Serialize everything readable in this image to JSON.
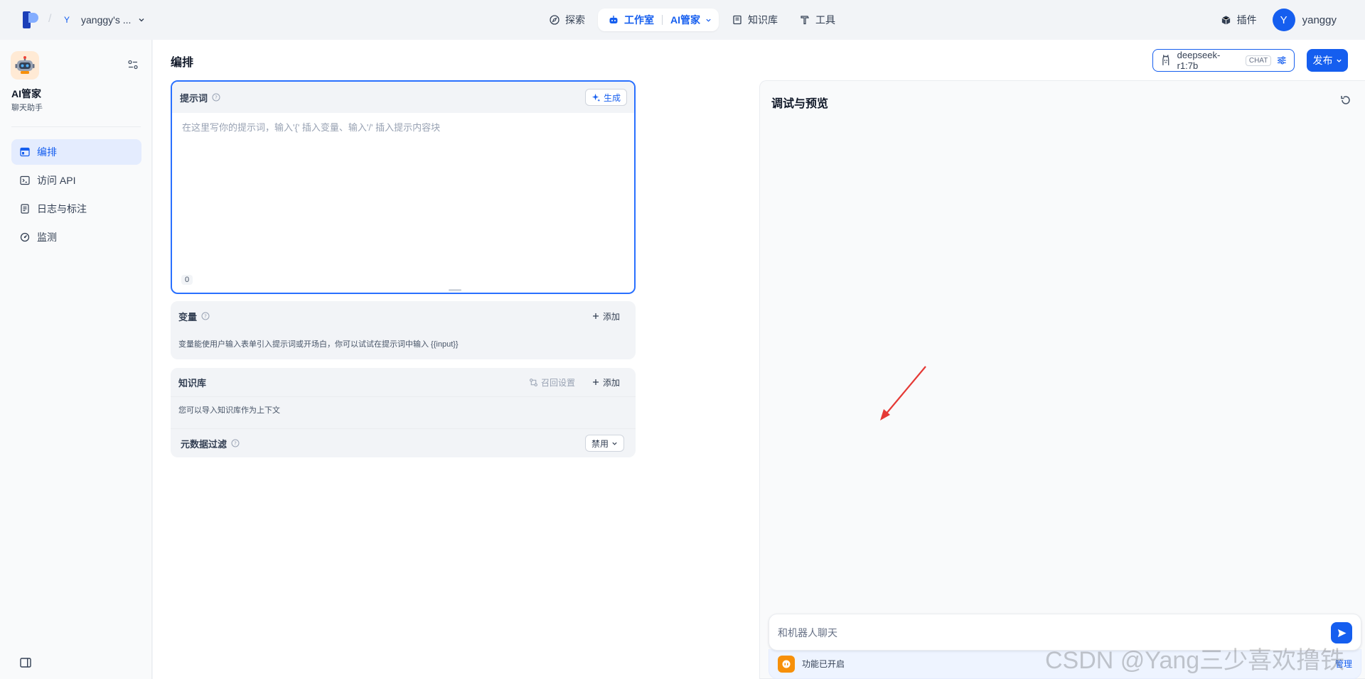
{
  "topnav": {
    "workspace_initial": "Y",
    "workspace_name": "yanggy's ...",
    "items": {
      "explore": "探索",
      "studio": "工作室",
      "current_app": "AI管家",
      "knowledge": "知识库",
      "tools": "工具"
    },
    "plugins": "插件",
    "user_initial": "Y",
    "user_name": "yanggy"
  },
  "sidebar": {
    "app_name": "AI管家",
    "app_type": "聊天助手",
    "items": [
      {
        "label": "编排"
      },
      {
        "label": "访问 API"
      },
      {
        "label": "日志与标注"
      },
      {
        "label": "监测"
      }
    ]
  },
  "header": {
    "title": "编排",
    "model_name": "deepseek-r1:7b",
    "model_tag": "CHAT",
    "publish": "发布"
  },
  "prompt": {
    "title": "提示词",
    "generate": "生成",
    "placeholder": "在这里写你的提示词，输入'{' 插入变量、输入'/' 插入提示内容块",
    "count": "0"
  },
  "variables": {
    "title": "变量",
    "add": "添加",
    "desc": "变量能使用户输入表单引入提示词或开场白，你可以试试在提示词中输入 {{input}}"
  },
  "knowledge": {
    "title": "知识库",
    "recall": "召回设置",
    "add": "添加",
    "desc": "您可以导入知识库作为上下文",
    "metadata_title": "元数据过滤",
    "metadata_value": "禁用"
  },
  "preview": {
    "title": "调试与预览",
    "input_placeholder": "和机器人聊天",
    "feature_text": "功能已开启",
    "feature_manage": "管理"
  },
  "watermark": "CSDN @Yang三少喜欢撸铁",
  "colors": {
    "accent": "#155EEF",
    "annotation": "#E53935",
    "feature_icon": "#F79009"
  }
}
